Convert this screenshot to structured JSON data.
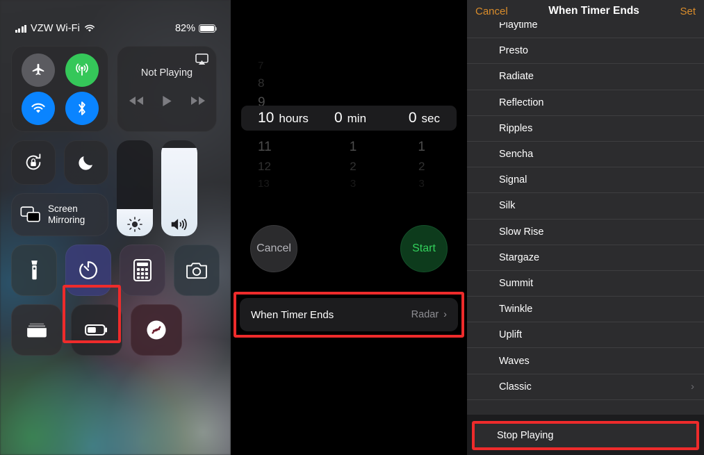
{
  "control_center": {
    "status_bar": {
      "carrier": "VZW Wi-Fi",
      "battery_percent": "82%",
      "signal_icon": "cellular-bars-icon",
      "wifi_icon": "wifi-icon",
      "battery_icon": "battery-icon"
    },
    "connectivity": {
      "airplane": {
        "name": "airplane-mode-toggle",
        "icon": "airplane-icon",
        "color": "#5b5b60"
      },
      "cellular": {
        "name": "cellular-data-toggle",
        "icon": "cellular-antenna-icon",
        "color": "#35c759"
      },
      "wifi": {
        "name": "wifi-toggle",
        "icon": "wifi-icon",
        "color": "#0a84ff"
      },
      "bluetooth": {
        "name": "bluetooth-toggle",
        "icon": "bluetooth-icon",
        "color": "#0a84ff"
      }
    },
    "media": {
      "title": "Not Playing",
      "airplay_icon": "airplay-icon",
      "rewind_icon": "rewind-icon",
      "play_icon": "play-icon",
      "forward_icon": "fast-forward-icon"
    },
    "rotation_lock": {
      "label": "rotation-lock",
      "icon": "rotation-lock-icon"
    },
    "do_not_disturb": {
      "label": "do-not-disturb",
      "icon": "moon-icon"
    },
    "screen_mirroring": {
      "label_line1": "Screen",
      "label_line2": "Mirroring",
      "icon": "screen-mirroring-icon"
    },
    "brightness": {
      "icon": "brightness-icon",
      "level": "28"
    },
    "volume": {
      "icon": "volume-icon",
      "level": "92"
    },
    "shortcuts": [
      {
        "name": "flashlight-shortcut",
        "icon": "flashlight-icon"
      },
      {
        "name": "timer-shortcut",
        "icon": "timer-icon",
        "highlighted": true
      },
      {
        "name": "calculator-shortcut",
        "icon": "calculator-icon"
      },
      {
        "name": "camera-shortcut",
        "icon": "camera-icon"
      },
      {
        "name": "wallet-shortcut",
        "icon": "wallet-icon"
      },
      {
        "name": "low-power-shortcut",
        "icon": "battery-icon"
      },
      {
        "name": "shazam-shortcut",
        "icon": "shazam-icon"
      }
    ],
    "highlight_color": "#ee2b2b"
  },
  "timer": {
    "picker": {
      "hours": {
        "value": "10",
        "unit": "hours",
        "above": [
          "7",
          "8",
          "9"
        ],
        "below": [
          "11",
          "12",
          "13"
        ]
      },
      "minutes": {
        "value": "0",
        "unit": "min",
        "above": [],
        "below": [
          "1",
          "2",
          "3"
        ]
      },
      "seconds": {
        "value": "0",
        "unit": "sec",
        "above": [],
        "below": [
          "1",
          "2",
          "3"
        ]
      }
    },
    "cancel_label": "Cancel",
    "start_label": "Start",
    "when_timer_ends": {
      "label": "When Timer Ends",
      "value": "Radar",
      "chevron": "›"
    }
  },
  "sound_picker": {
    "cancel_label": "Cancel",
    "title": "When Timer Ends",
    "set_label": "Set",
    "accent_color": "#d98c2b",
    "items": [
      {
        "label": "Playtime",
        "chevron": ""
      },
      {
        "label": "Presto",
        "chevron": ""
      },
      {
        "label": "Radiate",
        "chevron": ""
      },
      {
        "label": "Reflection",
        "chevron": ""
      },
      {
        "label": "Ripples",
        "chevron": ""
      },
      {
        "label": "Sencha",
        "chevron": ""
      },
      {
        "label": "Signal",
        "chevron": ""
      },
      {
        "label": "Silk",
        "chevron": ""
      },
      {
        "label": "Slow Rise",
        "chevron": ""
      },
      {
        "label": "Stargaze",
        "chevron": ""
      },
      {
        "label": "Summit",
        "chevron": ""
      },
      {
        "label": "Twinkle",
        "chevron": ""
      },
      {
        "label": "Uplift",
        "chevron": ""
      },
      {
        "label": "Waves",
        "chevron": ""
      },
      {
        "label": "Classic",
        "chevron": "›"
      }
    ],
    "stop_playing_label": "Stop Playing"
  }
}
